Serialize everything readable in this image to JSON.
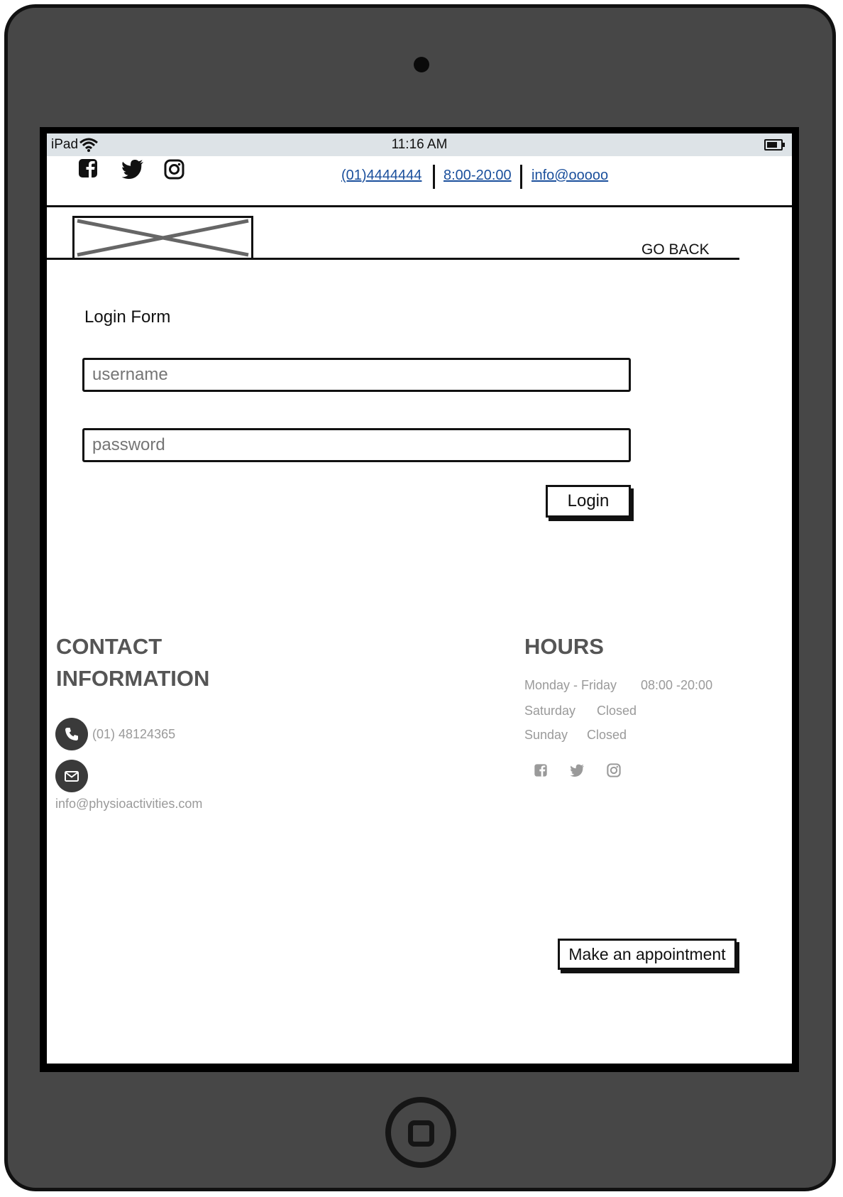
{
  "statusbar": {
    "carrier": "iPad",
    "time": "11:16 AM"
  },
  "topbar": {
    "phone": "(01)4444444",
    "hours": "8:00-20:00",
    "email": "info@ooooo"
  },
  "nav": {
    "go_back": "GO BACK"
  },
  "form": {
    "title": "Login Form",
    "username_placeholder": "username",
    "password_placeholder": "password",
    "login_label": "Login"
  },
  "footer": {
    "contact": {
      "heading_line1": "CONTACT",
      "heading_line2": "INFORMATION",
      "phone": "(01) 48124365",
      "email": "info@physioactivities.com"
    },
    "hours": {
      "heading": "HOURS",
      "rows": [
        {
          "day": "Monday - Friday",
          "time": "08:00 -20:00"
        },
        {
          "day": "Saturday",
          "time": "Closed"
        },
        {
          "day": "Sunday",
          "time": "Closed"
        }
      ]
    },
    "appointment_label": "Make an appointment"
  },
  "colors": {
    "device": "#474747",
    "status_bar": "#dde3e7",
    "link": "#1a4f9c",
    "footer_heading": "#555555",
    "footer_text": "#9a9a9a"
  },
  "icons": [
    "wifi-icon",
    "battery-icon",
    "facebook-icon",
    "twitter-icon",
    "instagram-icon",
    "phone-icon",
    "mail-icon",
    "home-button-icon"
  ]
}
